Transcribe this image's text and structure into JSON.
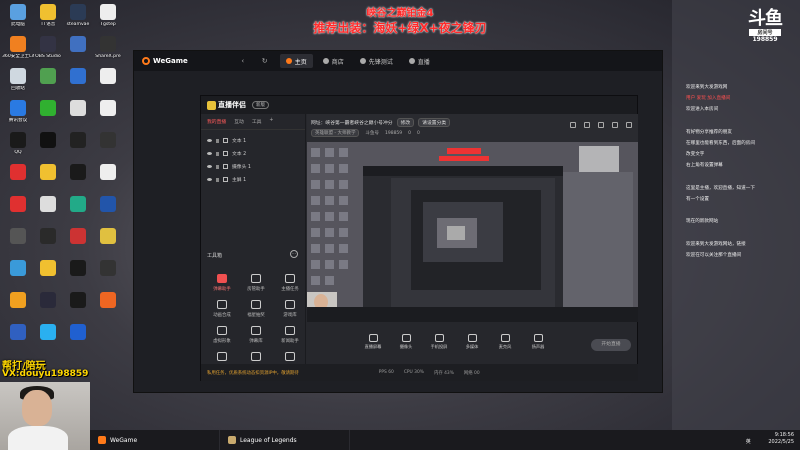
{
  "overlay": {
    "title1": "峡谷之巅铂金4",
    "title2": "推荐出装：海妖+绿X+夜之锋刃"
  },
  "desktop_icons": [
    {
      "label": "此电脑",
      "color": "#5aa0e0"
    },
    {
      "label": "TT语音",
      "color": "#f0c030"
    },
    {
      "label": "steamvae",
      "color": "#2b3b55"
    },
    {
      "label": "Tgstep",
      "color": "#eeeeee"
    },
    {
      "label": "360安全卫士Lite\n游戏清理",
      "color": "#f08020"
    },
    {
      "label": "OBS Studio",
      "color": "#333344"
    },
    {
      "label": "",
      "color": "#4070c0"
    },
    {
      "label": "ShareX.pre",
      "color": "#333333"
    },
    {
      "label": "回收站",
      "color": "#cfd8e0"
    },
    {
      "label": "",
      "color": "#50a050"
    },
    {
      "label": "",
      "color": "#3070d0"
    },
    {
      "label": "",
      "color": "#eeeeee"
    },
    {
      "label": "腾讯会议",
      "color": "#2a7ae2"
    },
    {
      "label": "",
      "color": "#30b030"
    },
    {
      "label": "",
      "color": "#dddddd"
    },
    {
      "label": "",
      "color": "#eeeeee"
    },
    {
      "label": "QQ",
      "color": "#1a1a1a"
    },
    {
      "label": "",
      "color": "#111111"
    },
    {
      "label": "",
      "color": "#222222"
    },
    {
      "label": "",
      "color": "#333333"
    },
    {
      "label": "",
      "color": "#e03030"
    },
    {
      "label": "",
      "color": "#f0c030"
    },
    {
      "label": "",
      "color": "#1a1a1a"
    },
    {
      "label": "",
      "color": "#eeeeee"
    },
    {
      "label": "",
      "color": "#e03030"
    },
    {
      "label": "",
      "color": "#dddddd"
    },
    {
      "label": "",
      "color": "#22aa88"
    },
    {
      "label": "",
      "color": "#2255aa"
    },
    {
      "label": "",
      "color": "#555555"
    },
    {
      "label": "",
      "color": "#2a2a2a"
    },
    {
      "label": "",
      "color": "#cc3333"
    },
    {
      "label": "",
      "color": "#e0c040"
    },
    {
      "label": "",
      "color": "#3a9ad9"
    },
    {
      "label": "",
      "color": "#f0c030"
    },
    {
      "label": "",
      "color": "#1a1a1a"
    },
    {
      "label": "",
      "color": "#333333"
    },
    {
      "label": "",
      "color": "#f0a020"
    },
    {
      "label": "",
      "color": "#2a2a3a"
    },
    {
      "label": "",
      "color": "#1a1a1a"
    },
    {
      "label": "",
      "color": "#ee6622"
    },
    {
      "label": "",
      "color": "#3060c0"
    },
    {
      "label": "",
      "color": "#2ab0f0"
    },
    {
      "label": "",
      "color": "#2060d0"
    }
  ],
  "wegame": {
    "logo": "WeGame",
    "tabs": [
      {
        "label": "主页",
        "active": true,
        "dot": "#ff7a1a"
      },
      {
        "label": "商店",
        "active": false,
        "dot": "#aaaaaa"
      },
      {
        "label": "先锋测试",
        "active": false,
        "dot": "#aaaaaa"
      },
      {
        "label": "直播",
        "active": false,
        "dot": "#aaaaaa"
      }
    ]
  },
  "app": {
    "logo": "直播伴侣",
    "badge": "新版",
    "source_tabs": [
      "我的直播",
      "互动",
      "工具",
      "+"
    ],
    "sources": [
      "文本 1",
      "文本 2",
      "摄像头 1",
      "主屏 1"
    ],
    "tools_title": "工具箱",
    "tools": [
      "弹幕助手",
      "房管助手",
      "主播任务",
      "动画合成",
      "福星抽奖",
      "游戏库",
      "虚拟形象",
      "弹幕库",
      "新闻助手",
      "",
      "",
      ""
    ],
    "info_row1": [
      "网址：峡谷第一霸者峡谷之巅小号冲分",
      "修改",
      "请设置分类"
    ],
    "info_row2": [
      "英雄联盟 - 大师教学",
      "斗鱼号",
      "198859",
      "0",
      "0"
    ],
    "bottom_tools": [
      "直播屏幕",
      "摄像头",
      "手机投屏",
      "多媒体",
      "麦克风",
      "扬声器"
    ],
    "live_button": "开始直播",
    "status": [
      "私用任务，优质系统动态扣资源IP中，敬请期待",
      "PPS 60",
      "CPU 30%",
      "内存 43%",
      "网络 00"
    ]
  },
  "right_panel": {
    "logo_top": "斗鱼",
    "logo_sub": "房间号",
    "room_no": "198859",
    "lines": [
      "欢迎来到大发游戏网",
      "用户 爱玩 加入直播间",
      "欢迎进入本房间",
      "",
      "有好物分享推荐的朋友",
      "在哪里也能看到东西，后面的房间",
      "改变文字",
      "右上角有设置弹幕",
      "",
      "这里是主播，欢迎直播，知道一下",
      "有一个设置",
      "",
      "现在的新款网站",
      "",
      "欢迎来到大发游戏网站，链接",
      "欢迎在可以关注那个直播间"
    ]
  },
  "webcam": {
    "text1": "帮打/陪玩",
    "text2": "VX:douyu198859"
  },
  "taskbar": {
    "items": [
      {
        "label": "WeGame",
        "color": "#ff7a1a"
      },
      {
        "label": "League of Legends",
        "color": "#c8aa6e"
      }
    ],
    "time": "9:18:56",
    "date": "2022/5/25",
    "lang": "英"
  }
}
